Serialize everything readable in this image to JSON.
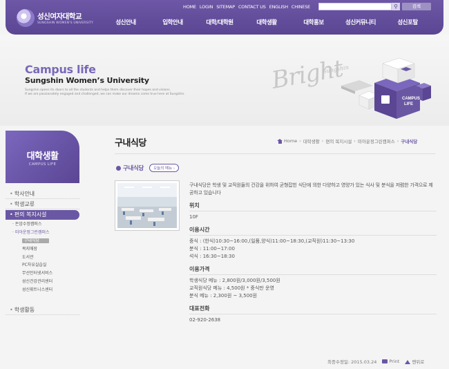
{
  "header": {
    "logo_ko": "성신여자대학교",
    "logo_en": "SUNGSHIN WOMEN'S UNIVERSITY",
    "util_links": [
      "HOME",
      "LOGIN",
      "SITEMAP",
      "CONTACT US",
      "ENGLISH",
      "CHINESE"
    ],
    "search_button": "검색",
    "gnb": [
      "성신안내",
      "입학안내",
      "대학/대학원",
      "대학생활",
      "대학홍보",
      "성신커뮤니티",
      "성신포탈"
    ]
  },
  "visual": {
    "title": "Campus life",
    "subtitle": "Sungshin Women’s University",
    "desc1": "Sungshin opens its doors to all the students and helps them discover their hopes and visions.",
    "desc2": "If we are passionately engaged and challenged, we can make our dreams come true here at Sungshin.",
    "bright": "Bright",
    "bright_sub": "Sungshin",
    "cube_label1": "CAMPUS",
    "cube_label2": "LIFE"
  },
  "lnb": {
    "head_ko": "대학생활",
    "head_en": "CAMPUS LIFE",
    "items": [
      {
        "label": "학사안내"
      },
      {
        "label": "학생교류"
      },
      {
        "label": "편의 복지시설"
      }
    ],
    "sub1": [
      "돈암수정캠퍼스",
      "미아운정그린캠퍼스"
    ],
    "sub2": [
      "구내식당",
      "복지매장",
      "도서관",
      "PC자유실습실",
      "무선인터넷서비스",
      "성신건강관리센터",
      "성신휘트니스센터"
    ],
    "last_item": "학생활동"
  },
  "content": {
    "page_title": "구내식당",
    "breadcrumb": [
      "Home",
      "대학생활",
      "편의 복지시설",
      "미아운정그린캠퍼스",
      "구내식당"
    ],
    "section_title": "구내식당",
    "menu_link": "오늘의 메뉴",
    "intro": "구내식당은 학생 및 교직원들의 건강을 위하여 균형잡힌 식단에 의한 다양하고 영양가 있는 식사 및 분식을 저렴한 가격으로 제공하고 있습니다",
    "location_h": "위치",
    "location_v": "10F",
    "hours_h": "이용시간",
    "hours_v": [
      "중식 : (한식)10:30~16:00,(일품,양식)11:00~18:30,(교직원)11:30~13:30",
      "분식 : 11:00~17:00",
      "석식 : 16:30~18:30"
    ],
    "price_h": "이용가격",
    "price_v": [
      "학생식당 메뉴 : 2,800원/3,000원/3,500원",
      "교직원식당 메뉴 : 4,500원 * 중식만 운영",
      "분식 메뉴 : 2,300원 ~ 3,500원"
    ],
    "phone_h": "대표전화",
    "phone_v": "02-920-2638"
  },
  "footer": {
    "updated": "최종수정일: 2015.03.24",
    "print": "Print",
    "top": "맨위로"
  }
}
